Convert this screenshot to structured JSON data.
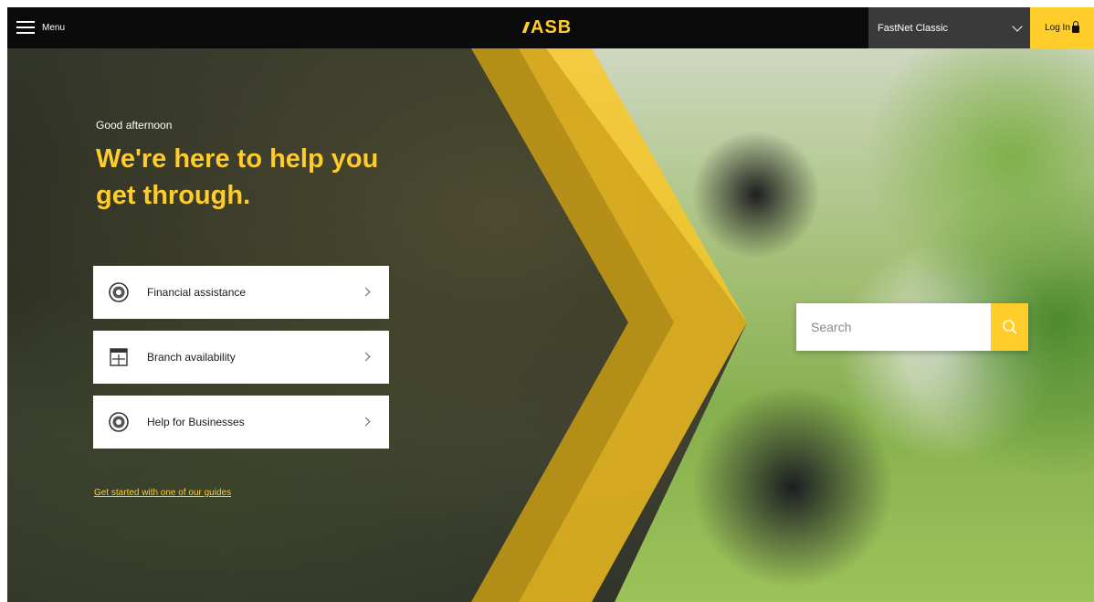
{
  "header": {
    "menu_label": "Menu",
    "logo_text": "ASB",
    "channel_select": "FastNet Classic",
    "login_label": "Log In"
  },
  "hero": {
    "greeting": "Good afternoon",
    "headline": "We're here to help you get through.",
    "quick_links": [
      {
        "label": "Financial assistance",
        "icon": "lifebuoy-icon"
      },
      {
        "label": "Branch availability",
        "icon": "calendar-icon"
      },
      {
        "label": "Help for Businesses",
        "icon": "lifebuoy-icon"
      }
    ],
    "guides_link": "Get started with one of our guides"
  },
  "search": {
    "placeholder": "Search"
  },
  "colors": {
    "brand_yellow": "#ffcc2a",
    "topbar": "#0b0b0b",
    "select_bg": "#3a3a3a"
  }
}
